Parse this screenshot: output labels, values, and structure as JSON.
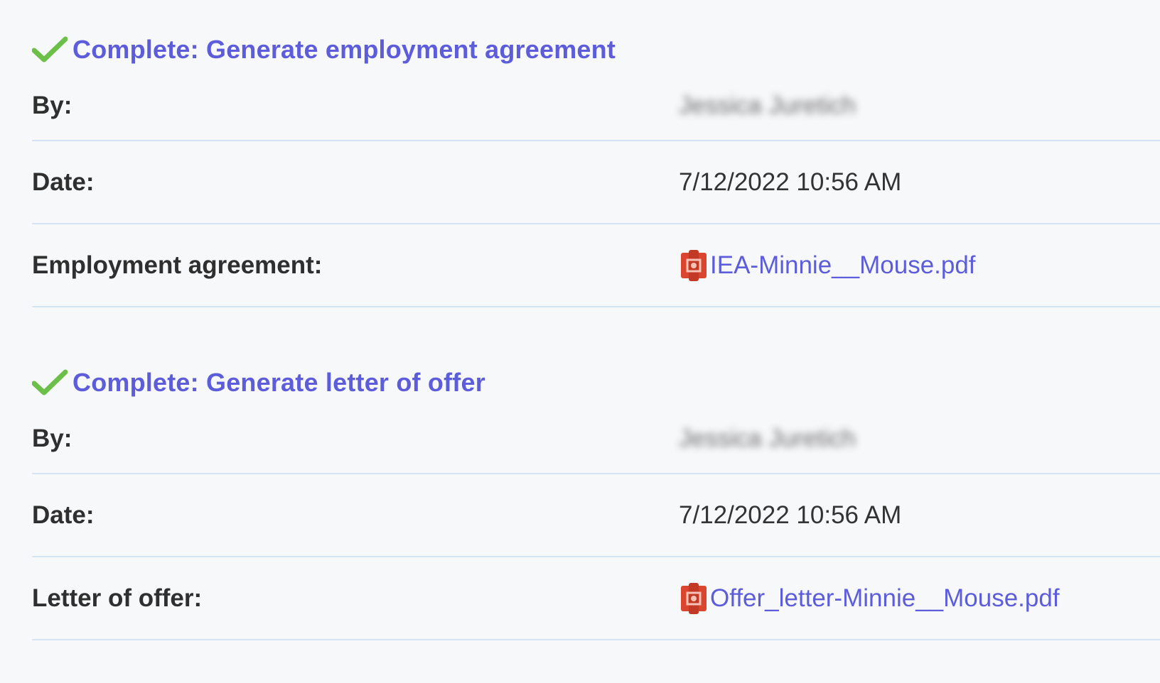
{
  "tasks": [
    {
      "title": "Complete: Generate employment agreement",
      "rows": [
        {
          "label": "By:",
          "value": "Jessica Juretich"
        },
        {
          "label": "Date:",
          "value": "7/12/2022 10:56 AM"
        },
        {
          "label": "Employment agreement:",
          "file": "IEA-Minnie__Mouse.pdf"
        }
      ]
    },
    {
      "title": "Complete: Generate letter of offer",
      "rows": [
        {
          "label": "By:",
          "value": "Jessica Juretich"
        },
        {
          "label": "Date:",
          "value": "7/12/2022 10:56 AM"
        },
        {
          "label": "Letter of offer:",
          "file": "Offer_letter-Minnie__Mouse.pdf"
        }
      ]
    }
  ],
  "colors": {
    "accent": "#5d5ddb",
    "check": "#6cc04a",
    "divider": "#d4e3f5",
    "pdf_icon": "#d9452e",
    "background": "#f7f8fa"
  },
  "icons": {
    "complete": "check-icon",
    "file": "pdf-file-icon"
  }
}
